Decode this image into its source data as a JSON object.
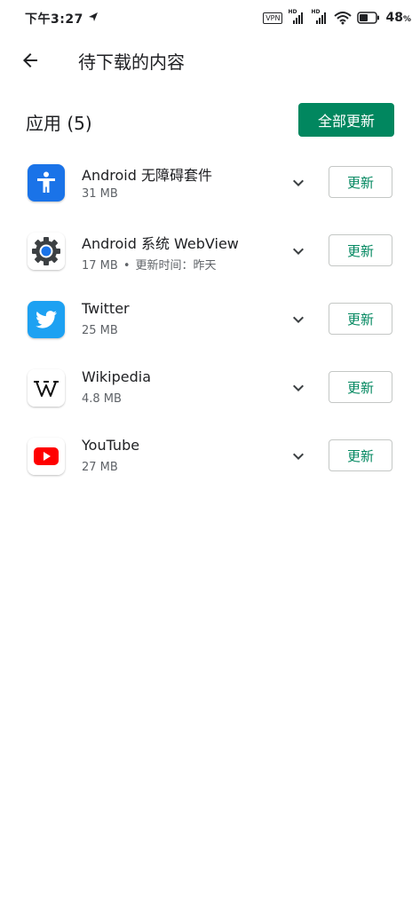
{
  "status_bar": {
    "time": "下午3:27",
    "vpn": "VPN",
    "hd1": "HD",
    "hd2": "HD",
    "battery_value": "48",
    "battery_unit": "%"
  },
  "app_bar": {
    "title": "待下载的内容"
  },
  "section": {
    "title": "应用 (5)",
    "update_all_label": "全部更新"
  },
  "apps": [
    {
      "name": "Android 无障碍套件",
      "size": "31 MB",
      "icon": "accessibility-icon"
    },
    {
      "name": "Android 系统 WebView",
      "size": "17 MB",
      "dot": "•",
      "extra": "更新时间：昨天",
      "icon": "webview-gear-icon"
    },
    {
      "name": "Twitter",
      "size": "25 MB",
      "icon": "twitter-icon"
    },
    {
      "name": "Wikipedia",
      "size": "4.8 MB",
      "icon": "wikipedia-icon"
    },
    {
      "name": "YouTube",
      "size": "27 MB",
      "icon": "youtube-icon"
    }
  ],
  "update_label": "更新",
  "colors": {
    "accent": "#01875f",
    "accessibility_bg": "#1a73e8",
    "twitter_bg": "#1da1f2",
    "youtube_red": "#ff0000"
  }
}
